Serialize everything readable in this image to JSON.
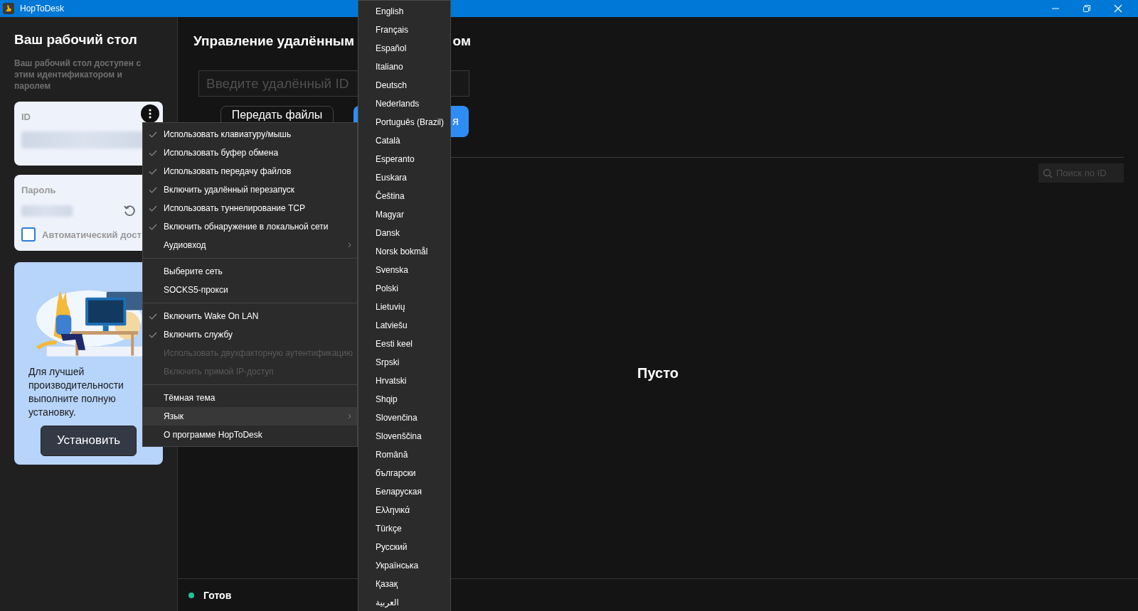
{
  "window": {
    "title": "HopToDesk"
  },
  "sidebar": {
    "title": "Ваш рабочий стол",
    "description": "Ваш рабочий стол доступен с этим идентификатором и паролем",
    "id_card": {
      "label": "ID"
    },
    "password_card": {
      "label": "Пароль",
      "auto_access": {
        "label": "Автоматический дост",
        "checked": false
      }
    },
    "promo": {
      "text": "Для лучшей производительности выполните полную установку.",
      "button": "Установить"
    }
  },
  "remote": {
    "title_parts": [
      "Управление удалённым",
      "ом"
    ],
    "id_field": {
      "placeholder": "Введите удалённый ID"
    },
    "buttons": [
      {
        "label": "Передать файлы",
        "kind": "outline"
      },
      {
        "label": "я",
        "kind": "primary"
      }
    ],
    "search": {
      "placeholder": "Поиск по ID"
    },
    "empty_text": "Пусто"
  },
  "status_bar": {
    "text": "Готов"
  },
  "context_menu": [
    {
      "kind": "item",
      "label": "Использовать клавиатуру/мышь",
      "checked": true,
      "disabled": false,
      "submenu": false,
      "selected": false
    },
    {
      "kind": "item",
      "label": "Использовать буфер обмена",
      "checked": true,
      "disabled": false,
      "submenu": false,
      "selected": false
    },
    {
      "kind": "item",
      "label": "Использовать передачу файлов",
      "checked": true,
      "disabled": false,
      "submenu": false,
      "selected": false
    },
    {
      "kind": "item",
      "label": "Включить удалённый перезапуск",
      "checked": true,
      "disabled": false,
      "submenu": false,
      "selected": false
    },
    {
      "kind": "item",
      "label": "Использовать туннелирование TCP",
      "checked": true,
      "disabled": false,
      "submenu": false,
      "selected": false
    },
    {
      "kind": "item",
      "label": "Включить обнаружение в локальной сети",
      "checked": true,
      "disabled": false,
      "submenu": false,
      "selected": false
    },
    {
      "kind": "item",
      "label": "Аудиовход",
      "checked": false,
      "disabled": false,
      "submenu": true,
      "selected": false
    },
    {
      "kind": "separator"
    },
    {
      "kind": "item",
      "label": "Выберите сеть",
      "checked": false,
      "disabled": false,
      "submenu": false,
      "selected": false
    },
    {
      "kind": "item",
      "label": "SOCKS5-прокси",
      "checked": false,
      "disabled": false,
      "submenu": false,
      "selected": false
    },
    {
      "kind": "separator"
    },
    {
      "kind": "item",
      "label": "Включить Wake On LAN",
      "checked": true,
      "disabled": false,
      "submenu": false,
      "selected": false
    },
    {
      "kind": "item",
      "label": "Включить службу",
      "checked": true,
      "disabled": false,
      "submenu": false,
      "selected": false
    },
    {
      "kind": "item",
      "label": "Использовать двухфакторную аутентификацию",
      "checked": false,
      "disabled": true,
      "submenu": false,
      "selected": false
    },
    {
      "kind": "item",
      "label": "Включить прямой IP-доступ",
      "checked": false,
      "disabled": true,
      "submenu": false,
      "selected": false
    },
    {
      "kind": "separator"
    },
    {
      "kind": "item",
      "label": "Тёмная тема",
      "checked": false,
      "disabled": false,
      "submenu": false,
      "selected": false
    },
    {
      "kind": "item",
      "label": "Язык",
      "checked": false,
      "disabled": false,
      "submenu": true,
      "selected": true
    },
    {
      "kind": "item",
      "label": "О программе HopToDesk",
      "checked": false,
      "disabled": false,
      "submenu": false,
      "selected": false
    }
  ],
  "language_menu": [
    "English",
    "Français",
    "Español",
    "Italiano",
    "Deutsch",
    "Nederlands",
    "Português (Brazil)",
    "Català",
    "Esperanto",
    "Euskara",
    "Čeština",
    "Magyar",
    "Dansk",
    "Norsk bokmål",
    "Svenska",
    "Polski",
    "Lietuvių",
    "Latviešu",
    "Eesti keel",
    "Srpski",
    "Hrvatski",
    "Shqip",
    "Slovenčina",
    "Slovenščina",
    "Română",
    "български",
    "Беларуская",
    "Ελληνικά",
    "Türkçe",
    "Русский",
    "Українська",
    "Қазақ",
    "العربية"
  ]
}
